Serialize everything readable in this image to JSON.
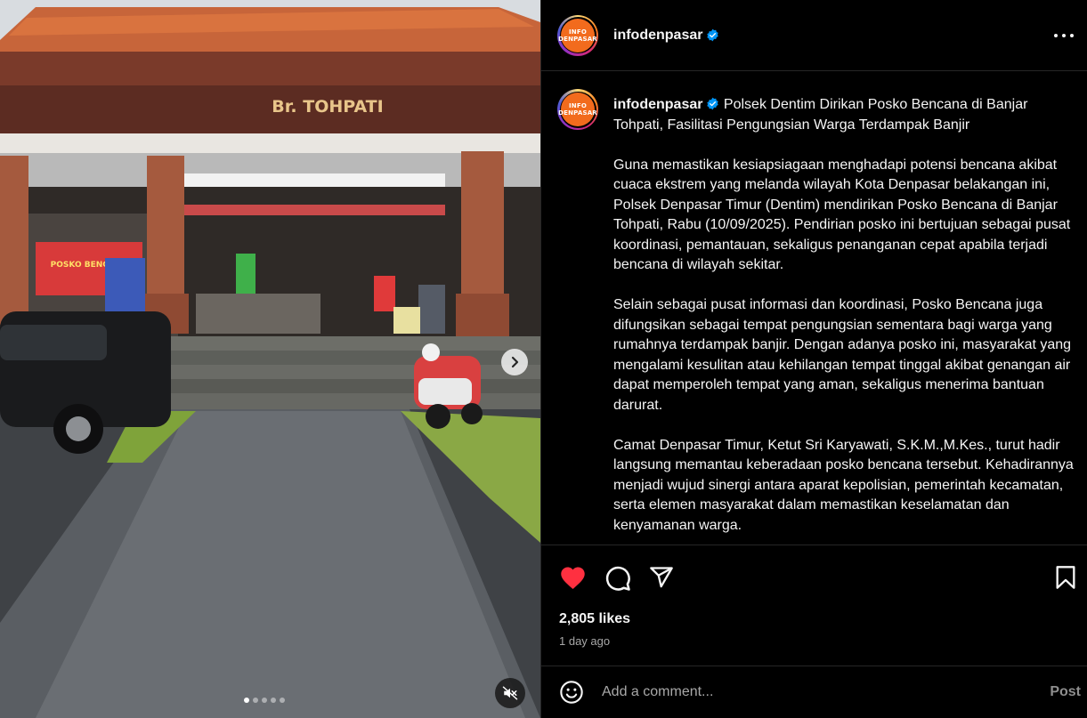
{
  "media": {
    "sign_text": "Br. TOHPATI",
    "banner_text": "POSKO BENCANA",
    "slide_count": 5,
    "active_slide": 1
  },
  "header": {
    "avatar_text": [
      "INFO",
      "DENPASAR"
    ],
    "username": "infodenpasar",
    "verified": true
  },
  "caption": {
    "username": "infodenpasar",
    "title": "Polsek Dentim Dirikan Posko Bencana di Banjar Tohpati, Fasilitasi Pengungsian Warga Terdampak Banjir",
    "paragraphs": [
      "Guna memastikan kesiapsiagaan menghadapi potensi bencana akibat cuaca ekstrem yang melanda wilayah Kota Denpasar belakangan ini, Polsek Denpasar Timur (Dentim) mendirikan Posko Bencana di Banjar Tohpati, Rabu (10/09/2025). Pendirian posko ini bertujuan sebagai pusat koordinasi, pemantauan, sekaligus penanganan cepat apabila terjadi bencana di wilayah sekitar.",
      "Selain sebagai pusat informasi dan koordinasi, Posko Bencana juga difungsikan sebagai tempat pengungsian sementara bagi warga yang rumahnya terdampak banjir. Dengan adanya posko ini, masyarakat yang mengalami kesulitan atau kehilangan tempat tinggal akibat genangan air dapat memperoleh tempat yang aman, sekaligus menerima bantuan darurat.",
      "Camat Denpasar Timur, Ketut Sri Karyawati, S.K.M.,M.Kes., turut hadir langsung memantau keberadaan posko bencana tersebut. Kehadirannya menjadi wujud sinergi antara aparat kepolisian, pemerintah kecamatan, serta elemen masyarakat dalam memastikan keselamatan dan kenyamanan warga."
    ]
  },
  "stats": {
    "likes": "2,805 likes",
    "time": "1 day ago"
  },
  "comment": {
    "placeholder": "Add a comment...",
    "post_label": "Post"
  },
  "colors": {
    "like_red": "#ff3040",
    "verified_blue": "#0095f6",
    "brand_orange": "#f26b1d"
  }
}
